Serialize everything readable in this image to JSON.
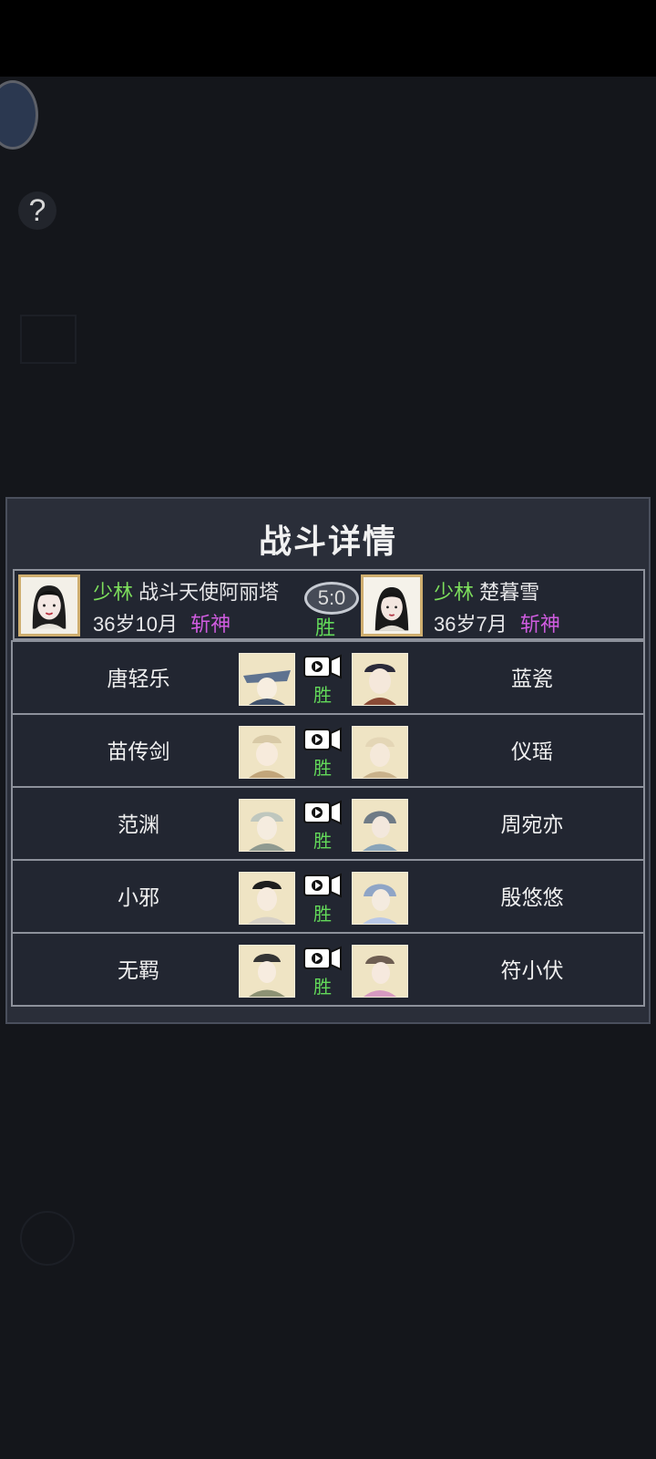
{
  "overlay_title": "战斗详情",
  "summary": {
    "left": {
      "sect": "少林",
      "name": "战斗天使阿丽塔",
      "age": "36岁10月",
      "rank": "斩神"
    },
    "score": "5:0",
    "result": "胜",
    "right": {
      "sect": "少林",
      "name": "楚暮雪",
      "age": "36岁7月",
      "rank": "斩神"
    }
  },
  "matches": [
    {
      "left": "唐轻乐",
      "right": "蓝瓷",
      "result": "胜"
    },
    {
      "left": "苗传剑",
      "right": "仪瑶",
      "result": "胜"
    },
    {
      "left": "范渊",
      "right": "周宛亦",
      "result": "胜"
    },
    {
      "left": "小邪",
      "right": "殷悠悠",
      "result": "胜"
    },
    {
      "left": "无羁",
      "right": "符小伏",
      "result": "胜"
    }
  ],
  "icons": {
    "help": "?",
    "replay": "video-replay-icon"
  },
  "colors": {
    "sect": "#7dde5c",
    "rank": "#d05ce0",
    "win": "#63d95a",
    "avatar_frame": "#cfae6f"
  }
}
